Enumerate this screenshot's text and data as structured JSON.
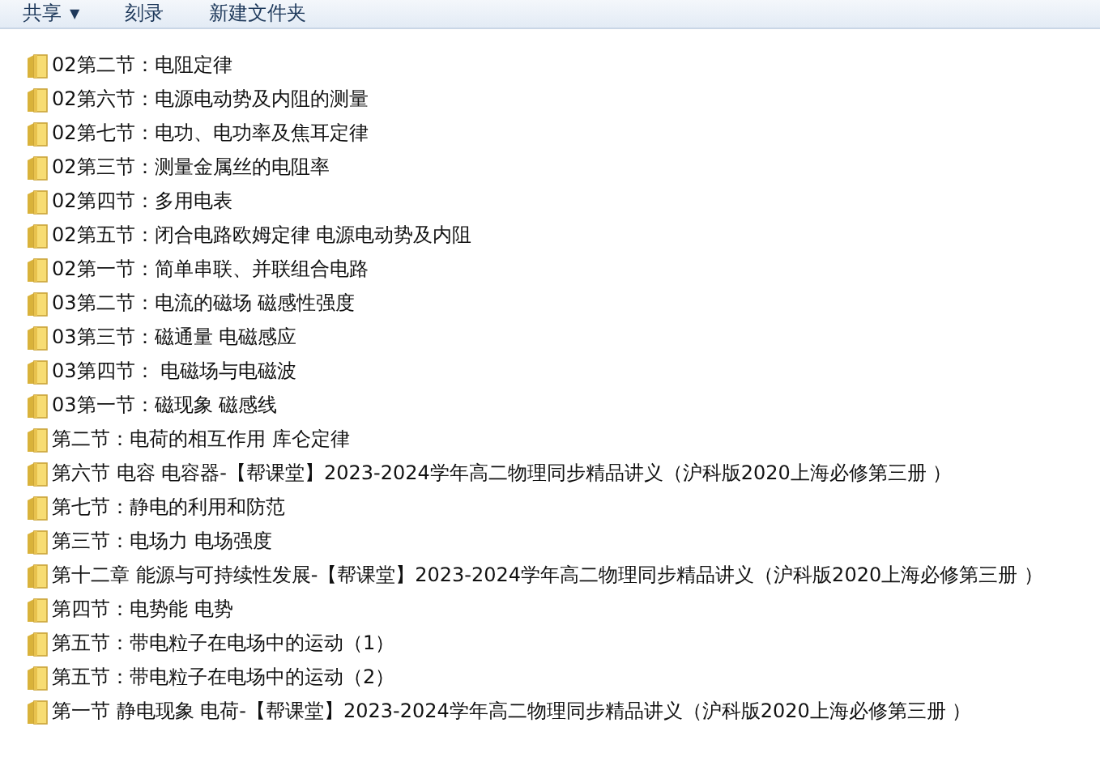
{
  "toolbar": [
    {
      "label": "共享",
      "caret": "▼"
    },
    {
      "label": "刻录"
    },
    {
      "label": "新建文件夹"
    }
  ],
  "files": [
    {
      "name": "02第二节：电阻定律"
    },
    {
      "name": "02第六节：电源电动势及内阻的测量"
    },
    {
      "name": "02第七节：电功、电功率及焦耳定律"
    },
    {
      "name": "02第三节：测量金属丝的电阻率"
    },
    {
      "name": "02第四节：多用电表"
    },
    {
      "name": "02第五节：闭合电路欧姆定律 电源电动势及内阻"
    },
    {
      "name": "02第一节：简单串联、并联组合电路"
    },
    {
      "name": "03第二节：电流的磁场 磁感性强度"
    },
    {
      "name": "03第三节：磁通量 电磁感应"
    },
    {
      "name": "03第四节： 电磁场与电磁波"
    },
    {
      "name": "03第一节：磁现象 磁感线"
    },
    {
      "name": "第二节：电荷的相互作用 库仑定律"
    },
    {
      "name": "第六节 电容 电容器-【帮课堂】2023-2024学年高二物理同步精品讲义（沪科版2020上海必修第三册 ）"
    },
    {
      "name": "第七节：静电的利用和防范"
    },
    {
      "name": "第三节：电场力 电场强度"
    },
    {
      "name": "第十二章 能源与可持续性发展-【帮课堂】2023-2024学年高二物理同步精品讲义（沪科版2020上海必修第三册 ）"
    },
    {
      "name": "第四节：电势能 电势"
    },
    {
      "name": "第五节：带电粒子在电场中的运动（1）"
    },
    {
      "name": "第五节：带电粒子在电场中的运动（2）"
    },
    {
      "name": "第一节 静电现象 电荷-【帮课堂】2023-2024学年高二物理同步精品讲义（沪科版2020上海必修第三册 ）"
    }
  ]
}
